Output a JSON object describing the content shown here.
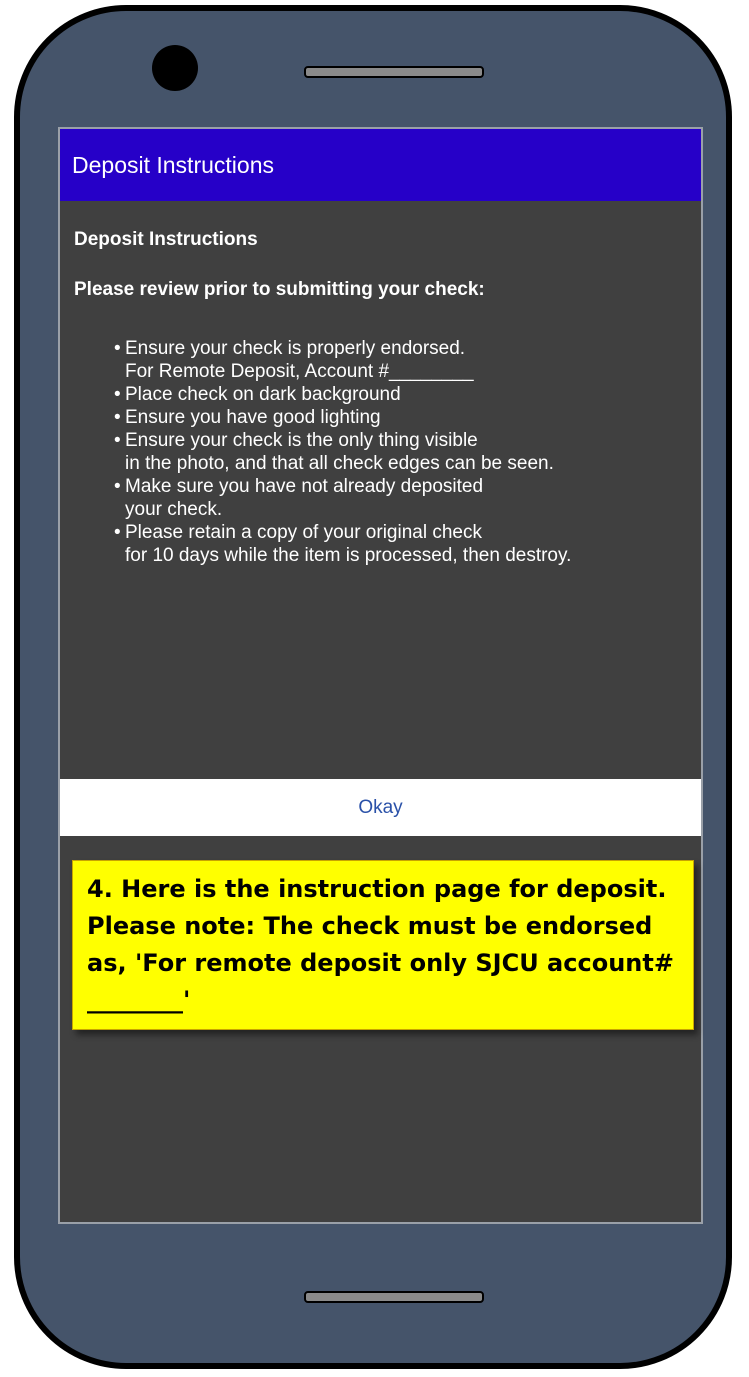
{
  "dialog": {
    "title": "Deposit Instructions",
    "heading": "Deposit Instructions",
    "subheading": "Please review prior to submitting your check:",
    "bullets": [
      {
        "line1": "Ensure your check is properly endorsed.",
        "line2": "For Remote Deposit, Account #________"
      },
      {
        "line1": "Place check on dark background",
        "line2": ""
      },
      {
        "line1": "Ensure you have good lighting",
        "line2": ""
      },
      {
        "line1": "Ensure your check is the only thing visible",
        "line2": "in the photo, and that all check edges can be seen."
      },
      {
        "line1": "Make sure you have not already deposited",
        "line2": "your check."
      },
      {
        "line1": "Please retain a copy of your original check",
        "line2": "for 10 days while the item is processed, then destroy."
      }
    ],
    "okay_label": "Okay"
  },
  "callout": {
    "text": "4. Here is the instruction page for deposit.\nPlease note: The check must be endorsed as, 'For remote deposit only SJCU account# ________'"
  },
  "colors": {
    "appbar": "#2600c8",
    "screen_bg": "#404040",
    "phone_body": "#45546a",
    "okay_text": "#2a51a8",
    "callout_bg": "#ffff00"
  }
}
